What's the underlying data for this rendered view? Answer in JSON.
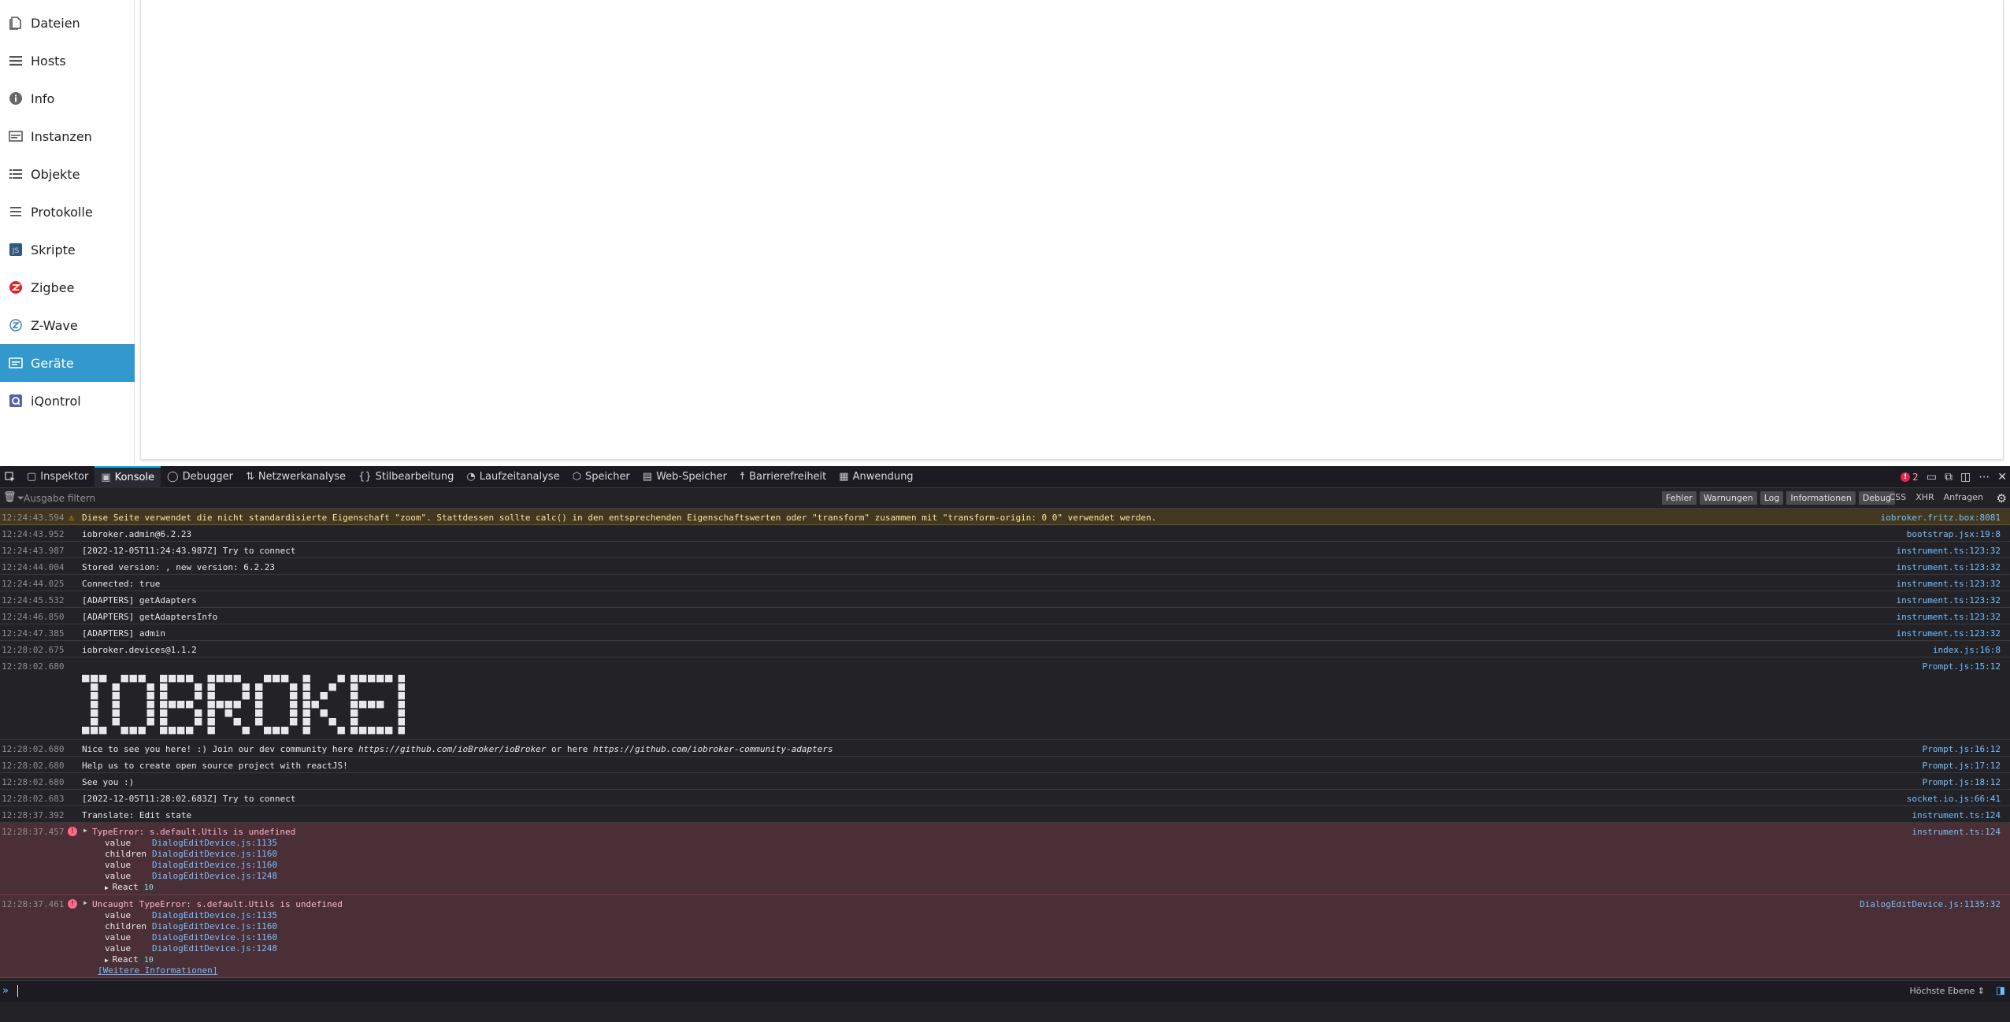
{
  "sidebar": {
    "items": [
      {
        "label": "Dateien",
        "icon": "file-icon"
      },
      {
        "label": "Hosts",
        "icon": "list-icon"
      },
      {
        "label": "Info",
        "icon": "info-icon"
      },
      {
        "label": "Instanzen",
        "icon": "instances-icon"
      },
      {
        "label": "Objekte",
        "icon": "objects-icon"
      },
      {
        "label": "Protokolle",
        "icon": "logs-icon"
      },
      {
        "label": "Skripte",
        "icon": "scripts-icon"
      },
      {
        "label": "Zigbee",
        "icon": "zigbee-icon"
      },
      {
        "label": "Z-Wave",
        "icon": "zwave-icon"
      },
      {
        "label": "Geräte",
        "icon": "devices-icon",
        "active": true
      },
      {
        "label": "iQontrol",
        "icon": "iqontrol-icon"
      }
    ]
  },
  "devtools": {
    "tabs": [
      "Inspektor",
      "Konsole",
      "Debugger",
      "Netzwerkanalyse",
      "Stilbearbeitung",
      "Laufzeitanalyse",
      "Speicher",
      "Web-Speicher",
      "Barrierefreiheit",
      "Anwendung"
    ],
    "active_tab": "Konsole",
    "error_count": "2",
    "filter_placeholder": "Ausgabe filtern",
    "levels": [
      "Fehler",
      "Warnungen",
      "Log",
      "Informationen",
      "Debug"
    ],
    "extra_filters": [
      "CSS",
      "XHR",
      "Anfragen"
    ],
    "eval_context": "Höchste Ebene",
    "colors": {
      "accent": "#00b3f4",
      "error_bg": "#4b2f36",
      "warn_bg": "#42381f",
      "link": "#75bfff",
      "active_nav": "#3399cc"
    }
  },
  "console": {
    "rows": [
      {
        "ts": "12:24:43.594",
        "msg": "Diese Seite verwendet die nicht standardisierte Eigenschaft \"zoom\". Stattdessen sollte calc() in den entsprechenden Eigenschaftswerten oder \"transform\" zusammen mit \"transform-origin: 0 0\" verwendet werden.",
        "src": "iobroker.fritz.box:8081",
        "level": "warn"
      },
      {
        "ts": "12:24:43.952",
        "msg": "iobroker.admin@6.2.23",
        "src": "bootstrap.jsx:19:8"
      },
      {
        "ts": "12:24:43.987",
        "msg": "[2022-12-05T11:24:43.987Z] Try to connect",
        "src": "instrument.ts:123:32"
      },
      {
        "ts": "12:24:44.004",
        "msg": "Stored version: , new version: 6.2.23",
        "src": "instrument.ts:123:32"
      },
      {
        "ts": "12:24:44.025",
        "msg": "Connected: true",
        "src": "instrument.ts:123:32"
      },
      {
        "ts": "12:24:45.532",
        "msg": "[ADAPTERS] getAdapters",
        "src": "instrument.ts:123:32"
      },
      {
        "ts": "12:24:46.850",
        "msg": "[ADAPTERS] getAdaptersInfo",
        "src": "instrument.ts:123:32"
      },
      {
        "ts": "12:24:47.385",
        "msg": "[ADAPTERS] admin",
        "src": "instrument.ts:123:32"
      },
      {
        "ts": "12:28:02.675",
        "msg": "iobroker.devices@1.1.2",
        "src": "index.js:16:8"
      },
      {
        "ts": "12:28:02.680",
        "msg": "",
        "src": "Prompt.js:15:12"
      },
      {
        "ts": "12:28:02.680",
        "msg_pre": "Nice to see you here! :) Join our dev community here ",
        "url1": "https://github.com/ioBroker/ioBroker",
        "msg_mid": " or here ",
        "url2": "https://github.com/iobroker-community-adapters",
        "src": "Prompt.js:16:12"
      },
      {
        "ts": "12:28:02.680",
        "msg": "Help us to create open source project with reactJS!",
        "src": "Prompt.js:17:12"
      },
      {
        "ts": "12:28:02.680",
        "msg": "See you :)",
        "src": "Prompt.js:18:12"
      },
      {
        "ts": "12:28:02.683",
        "msg": "[2022-12-05T11:28:02.683Z] Try to connect",
        "src": "socket.io.js:66:41"
      },
      {
        "ts": "12:28:37.392",
        "msg": "Translate: Edit state",
        "src": "instrument.ts:124"
      },
      {
        "ts": "12:28:37.457",
        "msg": "TypeError: s.default.Utils is undefined",
        "src": "instrument.ts:124",
        "level": "error"
      },
      {
        "ts": "12:28:37.461",
        "msg": "Uncaught TypeError: s.default.Utils is undefined",
        "src": "DialogEditDevice.js:1135:32",
        "level": "error"
      }
    ],
    "stack": [
      {
        "fn": "value",
        "loc": "DialogEditDevice.js:1135"
      },
      {
        "fn": "children",
        "loc": "DialogEditDevice.js:1160"
      },
      {
        "fn": "value",
        "loc": "DialogEditDevice.js:1160"
      },
      {
        "fn": "value",
        "loc": "DialogEditDevice.js:1248"
      }
    ],
    "react_label": "React",
    "react_count": "10",
    "more_info": "[Weitere Informationen]"
  }
}
